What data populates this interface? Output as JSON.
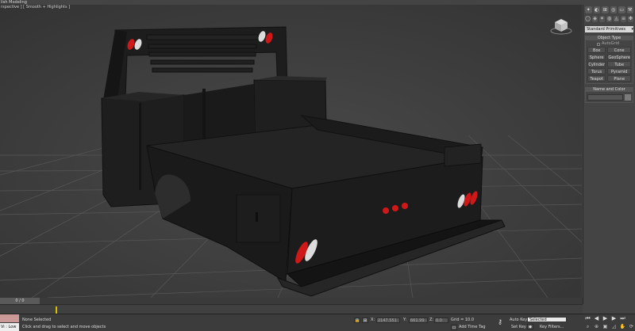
{
  "ribbon": {
    "tab_label": "lish Modeling"
  },
  "viewport": {
    "label": "rspective ] [ Smooth + Highlights ]"
  },
  "command_panel": {
    "main_tabs": [
      "✦",
      "◐",
      "⊞",
      "◎",
      "▭",
      "⚒"
    ],
    "sub_tabs": [
      "◯",
      "◈",
      "✶",
      "◍",
      "◬",
      "≡",
      "✤"
    ],
    "category_dropdown": "Standard Primitives",
    "object_type": {
      "title": "Object Type",
      "autogrid_label": "AutoGrid",
      "buttons": [
        "Box",
        "Cone",
        "Sphere",
        "GeoSphere",
        "Cylinder",
        "Tube",
        "Torus",
        "Pyramid",
        "Teapot",
        "Plane"
      ]
    },
    "name_color": {
      "title": "Name and Color"
    }
  },
  "timeline": {
    "slider_label": "0 / 0"
  },
  "statusbar": {
    "maxscript_low": "Vi : Low",
    "selection_text": "None Selected",
    "prompt_text": "Click and drag to select and move objects",
    "x_label": "X:",
    "x_value": "2147.551",
    "y_label": "Y:",
    "y_value": "661.99",
    "z_label": "Z:",
    "z_value": "0.0",
    "grid_text": "Grid = 10.0",
    "add_time_tag": "Add Time Tag",
    "auto_key": "Auto Key",
    "selected_dd": "Selected",
    "set_key": "Set Key",
    "key_filters": "Key Filters..."
  },
  "colors": {
    "viewport_bg": "#3d3d3d",
    "grid_line": "#5a5a5a",
    "truck_body": "#1c1c1c",
    "light_red": "#d01818",
    "light_white": "#dcdcdc",
    "timeline_key": "#d8c000"
  }
}
